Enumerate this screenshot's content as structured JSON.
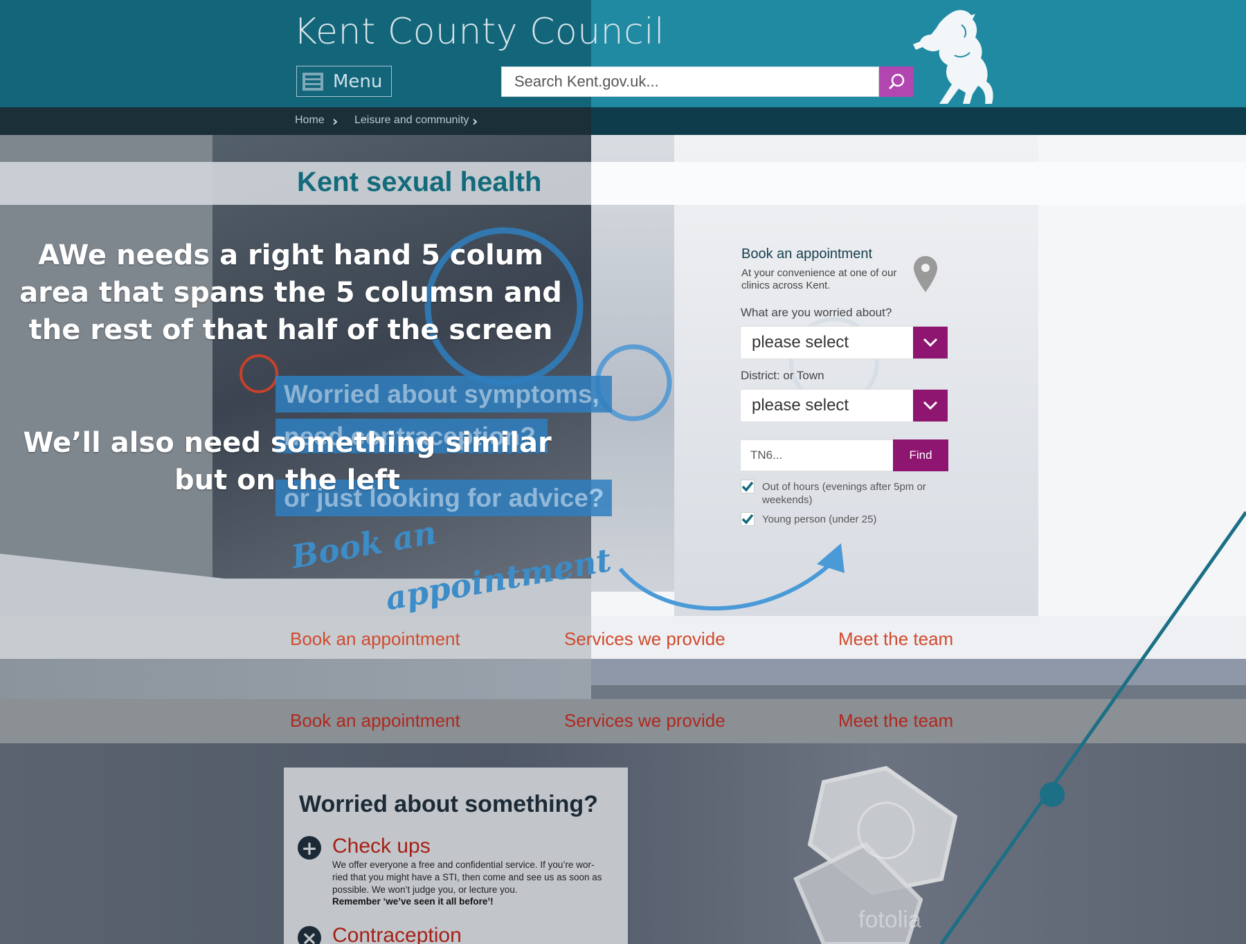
{
  "header": {
    "council_title": "Kent County Council",
    "menu_label": "Menu",
    "search_placeholder": "Search Kent.gov.uk..."
  },
  "breadcrumbs": [
    "Home",
    "Leisure and community"
  ],
  "page_title": "Kent sexual health",
  "annotations": {
    "note1": "AWe needs a right hand 5 colum area that spans the 5 columsn and the rest of that half of the screen",
    "note2": "We’ll also need something similar but on the left"
  },
  "hero": {
    "promo_lines": [
      "Worried about symptoms,",
      "need contraception?",
      "or just looking for advice?"
    ],
    "script_line1": "Book an",
    "script_line2": "appointment"
  },
  "booking": {
    "title": "Book an appointment",
    "subtitle": "At your convenience at one of our clinics across Kent.",
    "worried_label": "What are you worried about?",
    "worried_value": "please select",
    "district_label": "District: or Town",
    "district_value": "please select",
    "postcode_placeholder": "TN6...",
    "find_label": "Find",
    "checkbox_out_of_hours": "Out of hours (evenings after 5pm or weekends)",
    "checkbox_young_person": "Young person (under 25)"
  },
  "nav_primary": [
    "Book an appointment",
    "Services we provide",
    "Meet the team"
  ],
  "nav_secondary": [
    "Book an appointment",
    "Services we provide",
    "Meet the team"
  ],
  "worried_section": {
    "title": "Worried about something?",
    "checkups_title": "Check ups",
    "checkups_text": "We offer everyone a free and confidential service. If you’re wor-ried that you might have a STI, then come and see us as soon as possible. We won’t judge you, or lecture you.",
    "checkups_bold": "Remember ‘we’ve seen it all before’!",
    "contraception_title": "Contraception"
  },
  "watermark": "fotolia",
  "colors": {
    "header_teal": "#1f8aa2",
    "header_dark": "#13657a",
    "accent_magenta": "#8e1670",
    "search_button": "#b246b0",
    "link_red": "#d14a2e",
    "title_teal": "#136a7a"
  }
}
